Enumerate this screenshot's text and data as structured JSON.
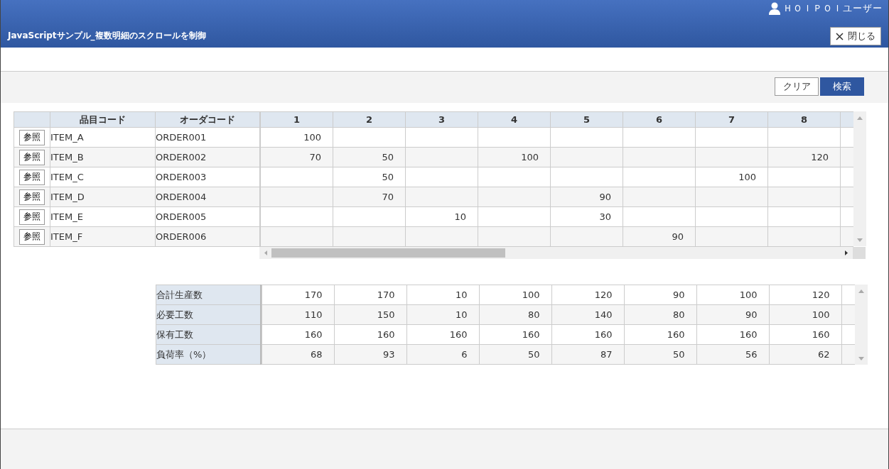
{
  "window": {
    "title": "JavaScriptサンプル_複数明細のスクロールを制御",
    "user": "ＨＯＩＰＯＩユーザー",
    "close_button": "閉じる"
  },
  "toolbar": {
    "buttons": [
      {
        "label": "クリア",
        "kind": "secondary"
      },
      {
        "label": "検索",
        "kind": "primary"
      }
    ]
  },
  "detail_table": {
    "fixed_columns": [
      "品目コード",
      "オーダコード"
    ],
    "period_columns": [
      "1",
      "2",
      "3",
      "4",
      "5",
      "6",
      "7",
      "8"
    ],
    "rows": [
      {
        "button": "参照",
        "item_code": "ITEM_A",
        "order_code": "ORDER001",
        "values": {
          "c1": "100"
        }
      },
      {
        "button": "参照",
        "item_code": "ITEM_B",
        "order_code": "ORDER002",
        "values": {
          "c1": "70",
          "c2": "50",
          "c4": "100",
          "c8": "120"
        }
      },
      {
        "button": "参照",
        "item_code": "ITEM_C",
        "order_code": "ORDER003",
        "values": {
          "c2": "50",
          "c7": "100"
        }
      },
      {
        "button": "参照",
        "item_code": "ITEM_D",
        "order_code": "ORDER004",
        "values": {
          "c2": "70",
          "c5": "90"
        }
      },
      {
        "button": "参照",
        "item_code": "ITEM_E",
        "order_code": "ORDER005",
        "values": {
          "c3": "10",
          "c5": "30"
        }
      },
      {
        "button": "参照",
        "item_code": "ITEM_F",
        "order_code": "ORDER006",
        "values": {
          "c6": "90"
        }
      }
    ]
  },
  "summary_table": {
    "rows": [
      {
        "label": "合計生産数",
        "values": [
          "170",
          "170",
          "10",
          "100",
          "120",
          "90",
          "100",
          "120"
        ]
      },
      {
        "label": "必要工数",
        "values": [
          "110",
          "150",
          "10",
          "80",
          "140",
          "80",
          "90",
          "100"
        ]
      },
      {
        "label": "保有工数",
        "values": [
          "160",
          "160",
          "160",
          "160",
          "160",
          "160",
          "160",
          "160"
        ]
      },
      {
        "label": "負荷率（%）",
        "values": [
          "68",
          "93",
          "6",
          "50",
          "87",
          "50",
          "56",
          "62"
        ]
      }
    ]
  }
}
